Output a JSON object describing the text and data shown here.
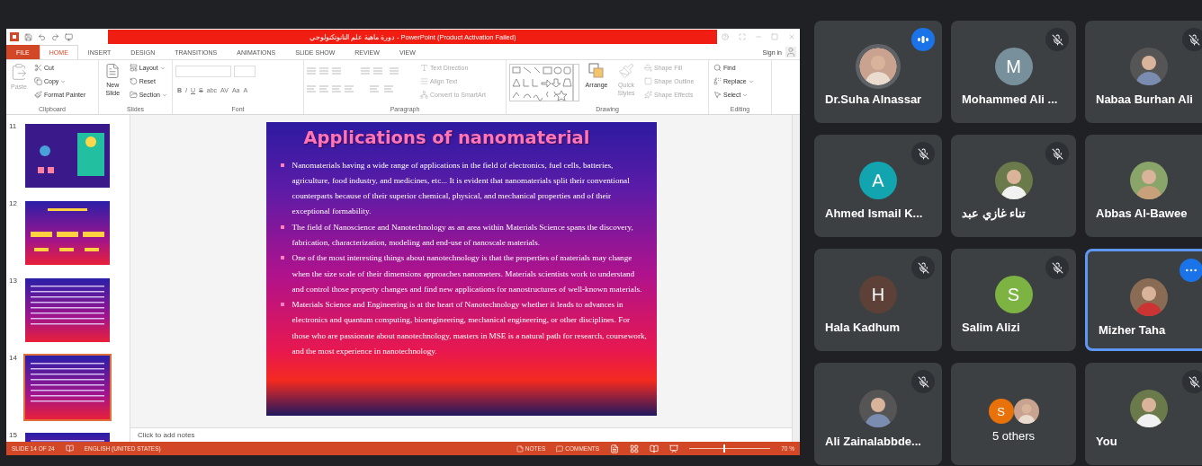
{
  "powerpoint": {
    "title": "دورة ماهية علم النانوتكنولوجي - PowerPoint (Product Activation Failed)",
    "tabs": [
      {
        "label": "FILE",
        "kind": "file",
        "selected": false
      },
      {
        "label": "HOME",
        "kind": "tab",
        "selected": true
      },
      {
        "label": "INSERT",
        "kind": "tab",
        "selected": false
      },
      {
        "label": "DESIGN",
        "kind": "tab",
        "selected": false
      },
      {
        "label": "TRANSITIONS",
        "kind": "tab",
        "selected": false
      },
      {
        "label": "ANIMATIONS",
        "kind": "tab",
        "selected": false
      },
      {
        "label": "SLIDE SHOW",
        "kind": "tab",
        "selected": false
      },
      {
        "label": "REVIEW",
        "kind": "tab",
        "selected": false
      },
      {
        "label": "VIEW",
        "kind": "tab",
        "selected": false
      }
    ],
    "sign_in": "Sign in",
    "ribbon": [
      {
        "kind": "clipboard",
        "label": "Clipboard",
        "paste": {
          "label": "Paste",
          "disabled": true
        },
        "commands": [
          {
            "label": "Cut",
            "dropdown": false,
            "disabled": false
          },
          {
            "label": "Copy",
            "dropdown": true,
            "disabled": false
          },
          {
            "label": "Format Painter",
            "dropdown": false,
            "disabled": false
          }
        ]
      },
      {
        "kind": "slides",
        "label": "Slides",
        "new_slide": "New Slide",
        "commands": [
          {
            "label": "Layout",
            "dropdown": true,
            "disabled": false
          },
          {
            "label": "Reset",
            "dropdown": false,
            "disabled": false
          },
          {
            "label": "Section",
            "dropdown": true,
            "disabled": false
          }
        ]
      },
      {
        "kind": "font",
        "label": "Font",
        "buttons": [
          "B",
          "I",
          "U",
          "S",
          "abc",
          "AV",
          "Aa",
          "A"
        ]
      },
      {
        "kind": "paragraph",
        "label": "Paragraph",
        "commands": [
          {
            "label": "Text Direction",
            "dropdown": false,
            "disabled": true
          },
          {
            "label": "Align Text",
            "dropdown": false,
            "disabled": true
          },
          {
            "label": "Convert to SmartArt",
            "dropdown": false,
            "disabled": true
          }
        ]
      },
      {
        "kind": "drawing",
        "label": "Drawing",
        "arrange": "Arrange",
        "quick_styles": {
          "label": "Quick Styles",
          "disabled": true
        },
        "commands": [
          {
            "label": "Shape Fill",
            "dropdown": false,
            "disabled": true
          },
          {
            "label": "Shape Outline",
            "dropdown": false,
            "disabled": true
          },
          {
            "label": "Shape Effects",
            "dropdown": false,
            "disabled": true
          }
        ]
      },
      {
        "kind": "editing",
        "label": "Editing",
        "commands": [
          {
            "label": "Find",
            "dropdown": false,
            "disabled": false
          },
          {
            "label": "Replace",
            "dropdown": true,
            "disabled": false
          },
          {
            "label": "Select",
            "dropdown": true,
            "disabled": false
          }
        ]
      }
    ],
    "thumbnails": [
      {
        "number": "11",
        "selected": false
      },
      {
        "number": "12",
        "selected": false
      },
      {
        "number": "13",
        "selected": false
      },
      {
        "number": "14",
        "selected": true
      },
      {
        "number": "15",
        "selected": false
      }
    ],
    "slide": {
      "title": "Applications of nanomaterial",
      "bullets": [
        "Nanomaterials having a wide range of applications in the field of electronics, fuel cells, batteries, agriculture, food industry, and medicines, etc... It is evident that nanomaterials split their conventional counterparts because of their superior chemical, physical, and  mechanical properties and of their exceptional formability.",
        "The field of Nanoscience and Nanotechnology as an area within Materials Science spans the discovery, fabrication, characterization, modeling and end-use of nanoscale materials.",
        "One of the most interesting things about nanotechnology is that the properties of materials may change when the size scale of their dimensions approaches nanometers. Materials scientists work to understand and control those property changes and find new applications for nanostructures of well-known materials.",
        "Materials Science and Engineering is at the heart of Nanotechnology whether it leads to advances in electronics and quantum computing, bioengineering, mechanical engineering, or other disciplines. For those who are passionate about nanotechnology, masters in MSE is a natural path for research, coursework, and the most experience in nanotechnology."
      ]
    },
    "notes_placeholder": "Click to add notes",
    "status_bar": {
      "slide": "SLIDE 14 OF 24",
      "language": "ENGLISH (UNITED STATES)",
      "notes": "NOTES",
      "comments": "COMMENTS",
      "zoom_slider": {
        "level": 0.42
      },
      "zoom": "70 %"
    }
  },
  "participants": [
    {
      "kind": "person",
      "name": "Dr.Suha Alnassar",
      "avatar": {
        "kind": "photo"
      },
      "speaking": true,
      "muted": false,
      "selected": false
    },
    {
      "kind": "person",
      "name": "Mohammed Ali ...",
      "avatar": {
        "kind": "letter",
        "letter": "M",
        "color": "#78909c"
      },
      "speaking": false,
      "muted": true,
      "selected": false
    },
    {
      "kind": "person",
      "name": "Nabaa Burhan Ali",
      "avatar": {
        "kind": "photo"
      },
      "speaking": false,
      "muted": true,
      "selected": false
    },
    {
      "kind": "person",
      "name": "Ahmed Ismail K...",
      "avatar": {
        "kind": "letter",
        "letter": "A",
        "color": "#12a4af"
      },
      "speaking": false,
      "muted": true,
      "selected": false
    },
    {
      "kind": "person",
      "name": "تناء غازي عبد",
      "avatar": {
        "kind": "photo"
      },
      "speaking": false,
      "muted": true,
      "selected": false
    },
    {
      "kind": "person",
      "name": "Abbas Al-Bawee",
      "avatar": {
        "kind": "photo"
      },
      "speaking": false,
      "muted": false,
      "selected": false
    },
    {
      "kind": "person",
      "name": "Hala Kadhum",
      "avatar": {
        "kind": "letter",
        "letter": "H",
        "color": "#5d4037"
      },
      "speaking": false,
      "muted": true,
      "selected": false
    },
    {
      "kind": "person",
      "name": "Salim Alizi",
      "avatar": {
        "kind": "letter",
        "letter": "S",
        "color": "#7cb342"
      },
      "speaking": false,
      "muted": true,
      "selected": false
    },
    {
      "kind": "person",
      "name": "Mizher Taha",
      "avatar": {
        "kind": "photo"
      },
      "speaking": false,
      "muted": false,
      "selected": true
    },
    {
      "kind": "person",
      "name": "Ali Zainalabbde...",
      "avatar": {
        "kind": "photo"
      },
      "speaking": false,
      "muted": true,
      "selected": false
    },
    {
      "kind": "others",
      "name": "5 others",
      "avatars": [
        {
          "kind": "letter",
          "letter": "S",
          "color": "#e8710a"
        },
        {
          "kind": "photo"
        }
      ],
      "speaking": false,
      "muted": false,
      "selected": false
    },
    {
      "kind": "person",
      "name": "You",
      "avatar": {
        "kind": "photo"
      },
      "speaking": false,
      "muted": true,
      "selected": false
    }
  ]
}
